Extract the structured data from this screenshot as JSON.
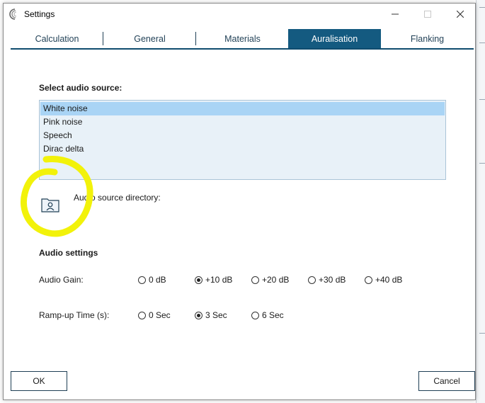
{
  "window": {
    "title": "Settings"
  },
  "tabs": [
    {
      "label": "Calculation",
      "active": false
    },
    {
      "label": "General",
      "active": false
    },
    {
      "label": "Materials",
      "active": false
    },
    {
      "label": "Auralisation",
      "active": true
    },
    {
      "label": "Flanking",
      "active": false
    }
  ],
  "audio_source": {
    "heading": "Select audio source:",
    "items": [
      "White noise",
      "Pink noise",
      "Speech",
      "Dirac delta"
    ],
    "selected_index": 0,
    "directory_label": "Audio source directory:"
  },
  "audio_settings": {
    "heading": "Audio settings",
    "gain": {
      "label": "Audio Gain:",
      "options": [
        "0 dB",
        "+10 dB",
        "+20 dB",
        "+30 dB",
        "+40 dB"
      ],
      "selected_index": 1
    },
    "ramp": {
      "label": "Ramp-up Time (s):",
      "options": [
        "0 Sec",
        "3 Sec",
        "6 Sec"
      ],
      "selected_index": 1
    }
  },
  "buttons": {
    "ok": "OK",
    "cancel": "Cancel"
  },
  "colors": {
    "tab_active": "#145a80",
    "tab_underline": "#0f4c6e",
    "list_bg": "#e8f1f8",
    "list_selected": "#a9d4f5",
    "annotation": "#f2f20a"
  }
}
